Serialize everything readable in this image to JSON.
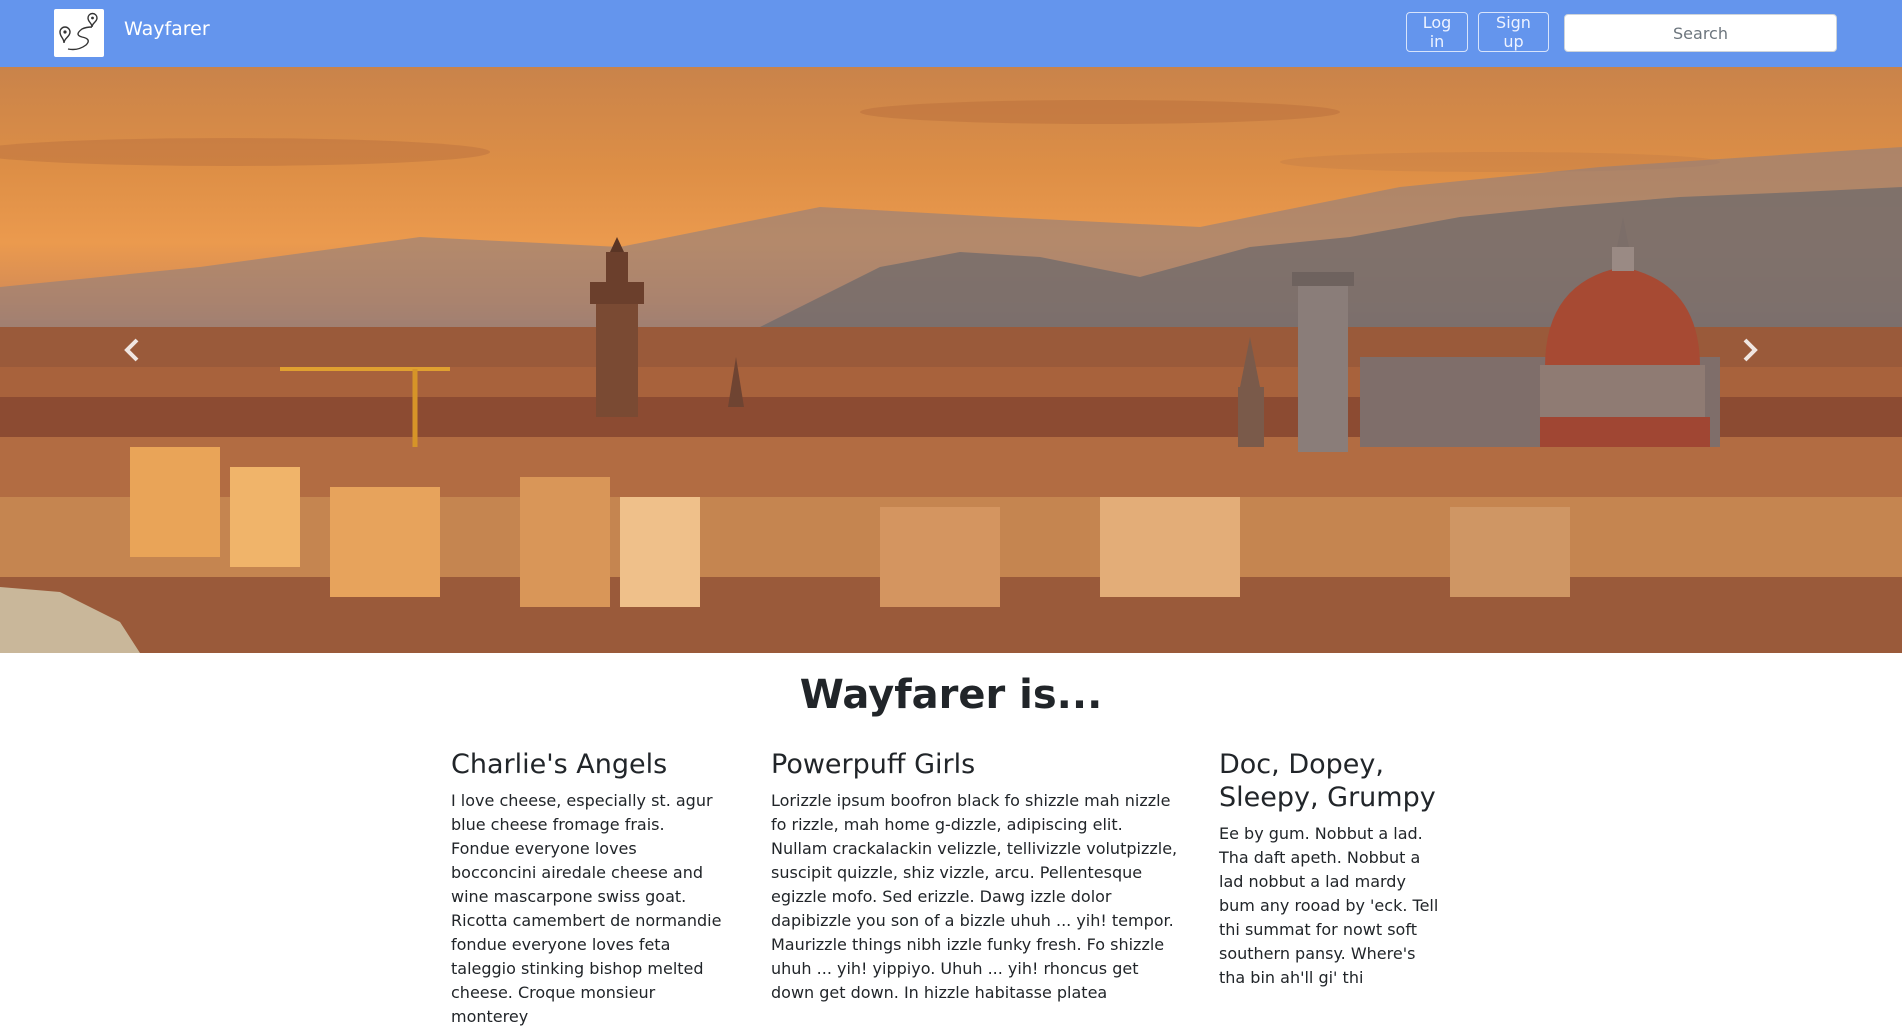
{
  "navbar": {
    "brand": "Wayfarer",
    "login_label": "Log in",
    "signup_label": "Sign up",
    "search_placeholder": "Search",
    "background_color": "#6495ed"
  },
  "hero": {
    "prev_icon": "chevron-left-icon",
    "next_icon": "chevron-right-icon"
  },
  "main": {
    "title": "Wayfarer is...",
    "columns": [
      {
        "heading": "Charlie's Angels",
        "text": "I love cheese, especially st. agur blue cheese fromage frais. Fondue everyone loves bocconcini airedale cheese and wine mascarpone swiss goat. Ricotta camembert de normandie fondue everyone loves feta taleggio stinking bishop melted cheese. Croque monsieur monterey"
      },
      {
        "heading": "Powerpuff Girls",
        "text": "Lorizzle ipsum boofron black fo shizzle mah nizzle fo rizzle, mah home g-dizzle, adipiscing elit. Nullam crackalackin velizzle, tellivizzle volutpizzle, suscipit quizzle, shiz vizzle, arcu. Pellentesque egizzle mofo. Sed erizzle. Dawg izzle dolor dapibizzle you son of a bizzle uhuh ... yih! tempor. Maurizzle things nibh izzle funky fresh. Fo shizzle uhuh ... yih! yippiyo. Uhuh ... yih! rhoncus get down get down. In hizzle habitasse platea"
      },
      {
        "heading": "Doc, Dopey, Sleepy, Grumpy",
        "text": "Ee by gum. Nobbut a lad. Tha daft apeth. Nobbut a lad nobbut a lad mardy bum any rooad by 'eck. Tell thi summat for nowt soft southern pansy. Where's tha bin ah'll gi' thi"
      }
    ]
  }
}
